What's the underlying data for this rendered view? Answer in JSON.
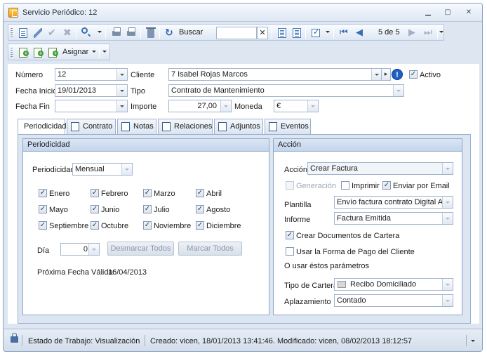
{
  "window": {
    "title": "Servicio Periódico: 12"
  },
  "toolbar": {
    "search_label": "Buscar",
    "search_value": "",
    "search_clear": "✕",
    "record_position": "5 de 5",
    "assign_label": "Asignar"
  },
  "form": {
    "numero_label": "Número",
    "numero_value": "12",
    "cliente_label": "Cliente",
    "cliente_value": "7  Isabel Rojas Marcos",
    "activo_label": "Activo",
    "fecha_inicio_label": "Fecha Inicio",
    "fecha_inicio_value": "19/01/2013",
    "tipo_label": "Tipo",
    "tipo_value": "Contrato de Mantenimiento",
    "fecha_fin_label": "Fecha Fin",
    "fecha_fin_value": "",
    "importe_label": "Importe",
    "importe_value": "27,00",
    "moneda_label": "Moneda",
    "moneda_value": "€"
  },
  "tabs": [
    {
      "label": "Periodicidad"
    },
    {
      "label": "Contrato"
    },
    {
      "label": "Notas"
    },
    {
      "label": "Relaciones"
    },
    {
      "label": "Adjuntos"
    },
    {
      "label": "Eventos"
    }
  ],
  "periodicidad": {
    "group_title": "Periodicidad",
    "periodicidad_label": "Periodicidad",
    "periodicidad_value": "Mensual",
    "months": [
      "Enero",
      "Febrero",
      "Marzo",
      "Abril",
      "Mayo",
      "Junio",
      "Julio",
      "Agosto",
      "Septiembre",
      "Octubre",
      "Noviembre",
      "Diciembre"
    ],
    "dia_label": "Día",
    "dia_value": "0",
    "desmarcar_label": "Desmarcar Todos",
    "marcar_label": "Marcar Todos",
    "proxima_label": "Próxima Fecha Válida:",
    "proxima_value": "16/04/2013"
  },
  "accion": {
    "group_title": "Acción",
    "accion_label": "Acción",
    "accion_value": "Crear Factura",
    "generacion_label": "Generación",
    "imprimir_label": "Imprimir",
    "enviar_label": "Enviar por Email",
    "plantilla_label": "Plantilla",
    "plantilla_value": "Envío factura contrato Digital Aurir",
    "informe_label": "Informe",
    "informe_value": "Factura Emitida",
    "crear_docs_label": "Crear Documentos de Cartera",
    "usar_forma_label": "Usar la Forma de Pago del Cliente",
    "usar_parametros_label": "O usar éstos parámetros",
    "tipo_cartera_label": "Tipo de Cartera",
    "tipo_cartera_value": "Recibo Domiciliado",
    "aplazamiento_label": "Aplazamiento",
    "aplazamiento_value": "Contado"
  },
  "status": {
    "estado": "Estado de Trabajo: Visualización",
    "info": "Creado: vicen, 18/01/2013 13:41:46. Modificado: vicen, 08/02/2013 18:12:57"
  }
}
